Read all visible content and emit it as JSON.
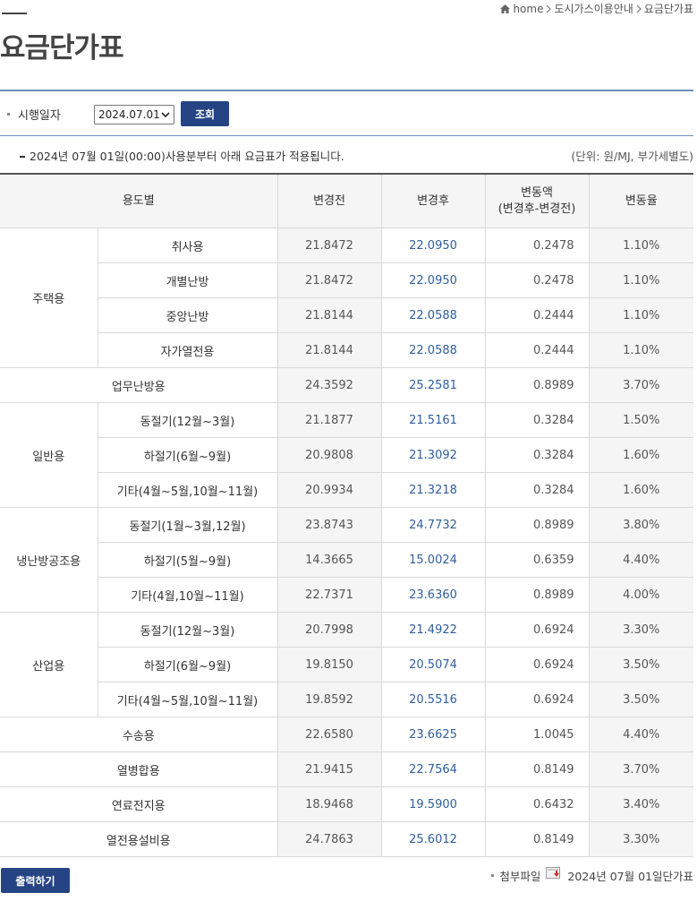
{
  "breadcrumb": {
    "home": "home",
    "level1": "도시가스이용안내",
    "level2": "요금단가표"
  },
  "page_title": "요금단가표",
  "filter": {
    "label": "시행일자",
    "selected_date": "2024.07.01",
    "search_label": "조회"
  },
  "notice": "2024년 07월 01일(00:00)사용분부터 아래 요금표가 적용됩니다.",
  "unit": "(단위: 원/MJ, 부가세별도)",
  "table": {
    "headers": {
      "usage": "용도별",
      "before": "변경전",
      "after": "변경후",
      "diff_line1": "변동액",
      "diff_line2": "(변경후-변경전)",
      "rate": "변동율"
    },
    "groups": {
      "residential": "주택용",
      "general": "일반용",
      "cooling": "냉난방공조용",
      "industrial": "산업용"
    },
    "rows": [
      {
        "sub": "취사용",
        "before": "21.8472",
        "after": "22.0950",
        "diff": "0.2478",
        "rate": "1.10%"
      },
      {
        "sub": "개별난방",
        "before": "21.8472",
        "after": "22.0950",
        "diff": "0.2478",
        "rate": "1.10%"
      },
      {
        "sub": "중앙난방",
        "before": "21.8144",
        "after": "22.0588",
        "diff": "0.2444",
        "rate": "1.10%"
      },
      {
        "sub": "자가열전용",
        "before": "21.8144",
        "after": "22.0588",
        "diff": "0.2444",
        "rate": "1.10%"
      },
      {
        "sub": "업무난방용",
        "before": "24.3592",
        "after": "25.2581",
        "diff": "0.8989",
        "rate": "3.70%"
      },
      {
        "sub": "동절기(12월~3월)",
        "before": "21.1877",
        "after": "21.5161",
        "diff": "0.3284",
        "rate": "1.50%"
      },
      {
        "sub": "하절기(6월~9월)",
        "before": "20.9808",
        "after": "21.3092",
        "diff": "0.3284",
        "rate": "1.60%"
      },
      {
        "sub": "기타(4월~5월,10월~11월)",
        "before": "20.9934",
        "after": "21.3218",
        "diff": "0.3284",
        "rate": "1.60%"
      },
      {
        "sub": "동절기(1월~3월,12월)",
        "before": "23.8743",
        "after": "24.7732",
        "diff": "0.8989",
        "rate": "3.80%"
      },
      {
        "sub": "하절기(5월~9월)",
        "before": "14.3665",
        "after": "15.0024",
        "diff": "0.6359",
        "rate": "4.40%"
      },
      {
        "sub": "기타(4월,10월~11월)",
        "before": "22.7371",
        "after": "23.6360",
        "diff": "0.8989",
        "rate": "4.00%"
      },
      {
        "sub": "동절기(12월~3월)",
        "before": "20.7998",
        "after": "21.4922",
        "diff": "0.6924",
        "rate": "3.30%"
      },
      {
        "sub": "하절기(6월~9월)",
        "before": "19.8150",
        "after": "20.5074",
        "diff": "0.6924",
        "rate": "3.50%"
      },
      {
        "sub": "기타(4월~5월,10월~11월)",
        "before": "19.8592",
        "after": "20.5516",
        "diff": "0.6924",
        "rate": "3.50%"
      },
      {
        "sub": "수송용",
        "before": "22.6580",
        "after": "23.6625",
        "diff": "1.0045",
        "rate": "4.40%"
      },
      {
        "sub": "열병합용",
        "before": "21.9415",
        "after": "22.7564",
        "diff": "0.8149",
        "rate": "3.70%"
      },
      {
        "sub": "연료전지용",
        "before": "18.9468",
        "after": "19.5900",
        "diff": "0.6432",
        "rate": "3.40%"
      },
      {
        "sub": "열전용설비용",
        "before": "24.7863",
        "after": "25.6012",
        "diff": "0.8149",
        "rate": "3.30%"
      }
    ]
  },
  "footer": {
    "print_label": "출력하기",
    "attach_label": "첨부파일",
    "attach_file": "2024년 07월 01일단가표"
  },
  "colors": {
    "primary_button": "#264484",
    "link_value": "#2f5e9d",
    "rule": "#6f8fb8"
  }
}
